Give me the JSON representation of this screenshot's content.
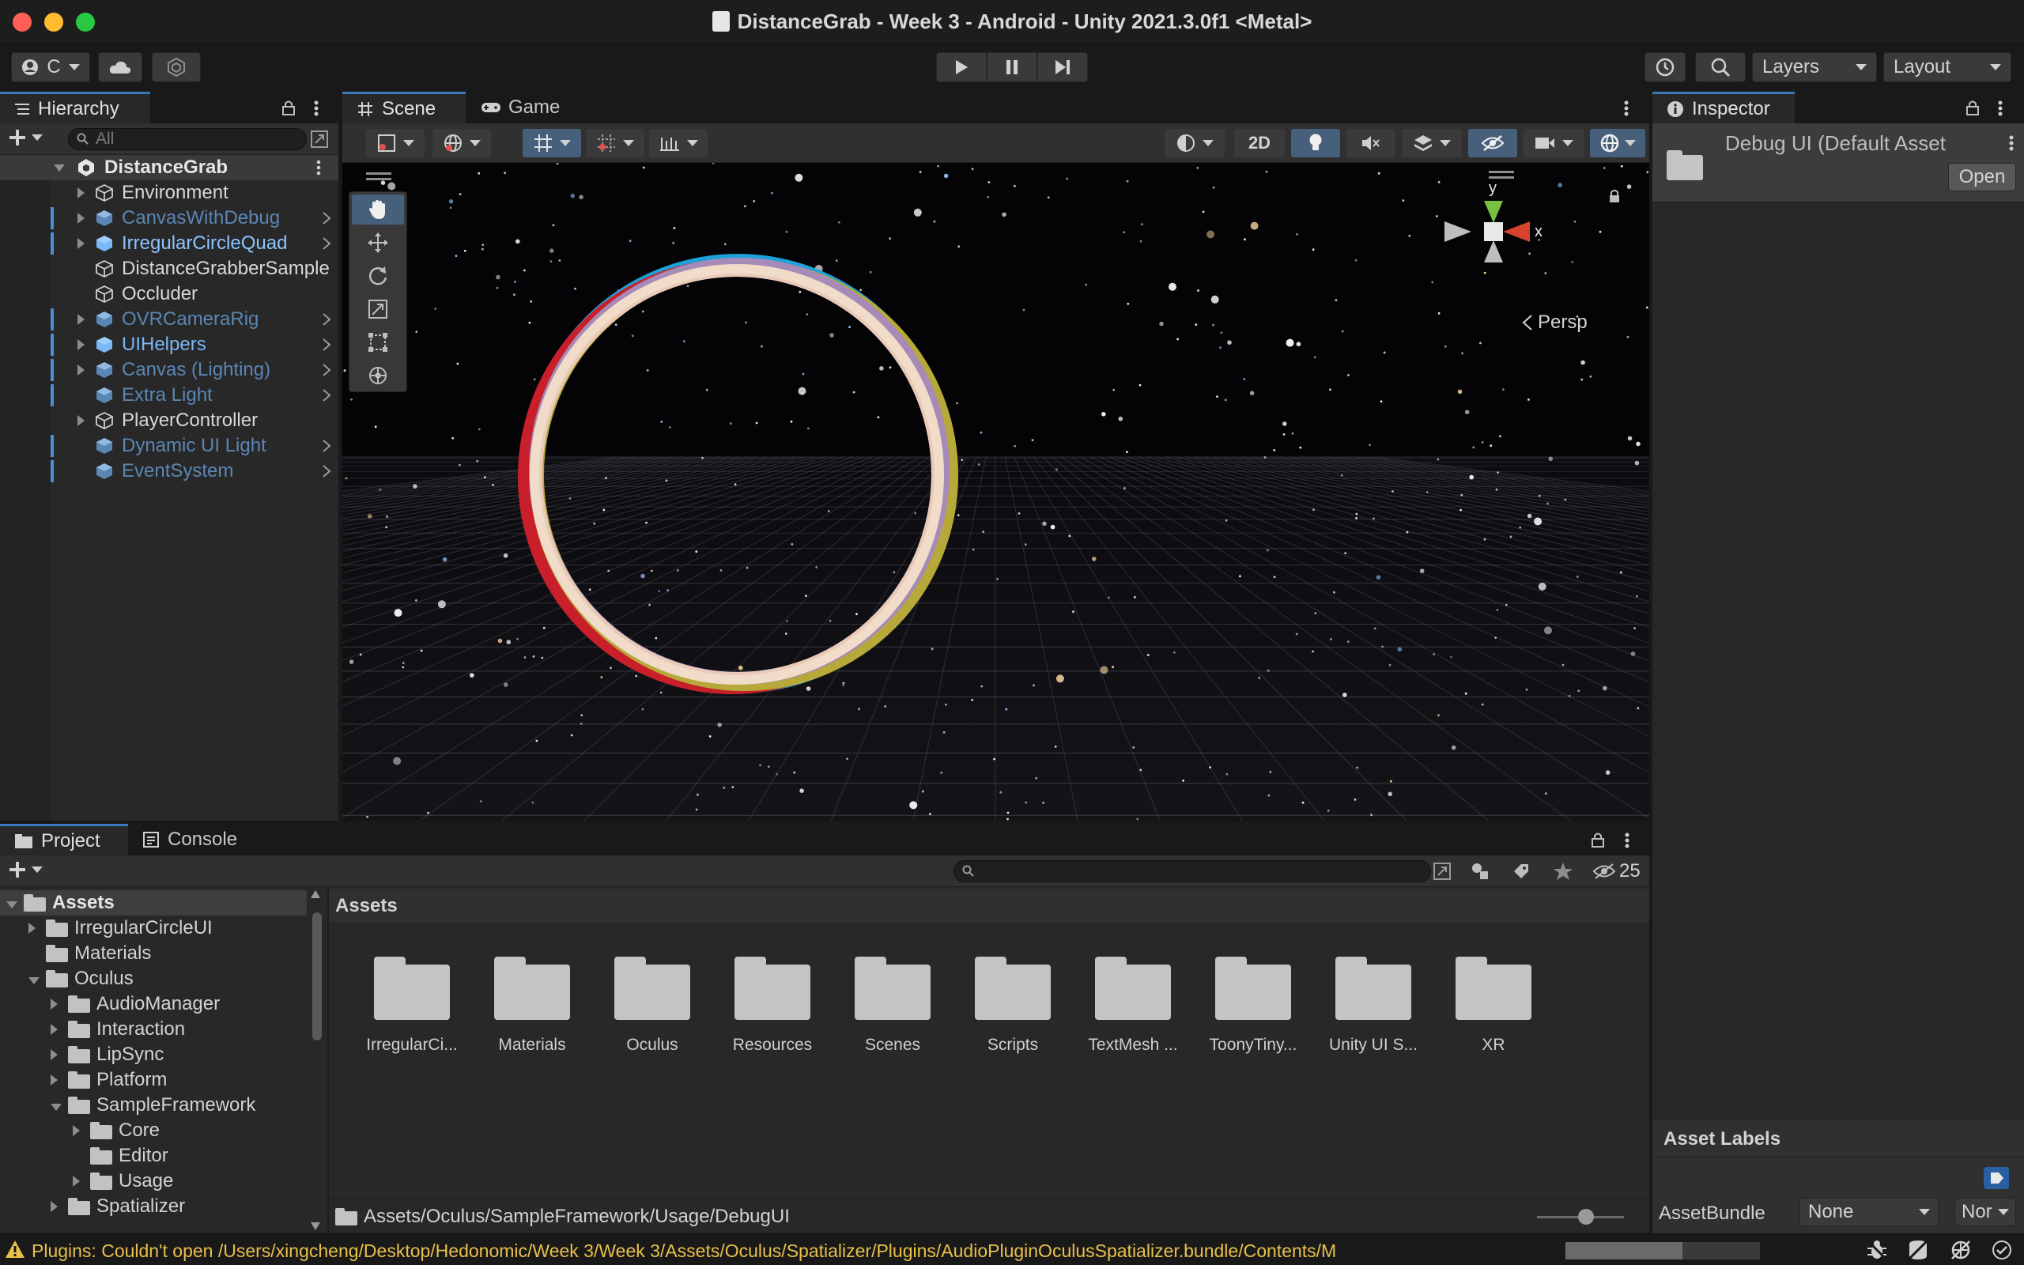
{
  "window": {
    "title": "DistanceGrab - Week 3 - Android - Unity 2021.3.0f1 <Metal>"
  },
  "toolbar": {
    "account_label": "C",
    "layers_label": "Layers",
    "layout_label": "Layout"
  },
  "hierarchy": {
    "tab_label": "Hierarchy",
    "search_placeholder": "All",
    "scene_name": "DistanceGrab",
    "items": [
      {
        "label": "Environment",
        "type": "object",
        "expandable": true
      },
      {
        "label": "CanvasWithDebug",
        "type": "prefab-inactive",
        "expandable": true,
        "chevron": true
      },
      {
        "label": "IrregularCircleQuad",
        "type": "prefab-selected",
        "expandable": true,
        "chevron": true
      },
      {
        "label": "DistanceGrabberSample",
        "type": "object",
        "expandable": false
      },
      {
        "label": "Occluder",
        "type": "object",
        "expandable": false
      },
      {
        "label": "OVRCameraRig",
        "type": "prefab-inactive",
        "expandable": true,
        "chevron": true
      },
      {
        "label": "UIHelpers",
        "type": "prefab",
        "expandable": true,
        "chevron": true
      },
      {
        "label": "Canvas (Lighting)",
        "type": "prefab-inactive",
        "expandable": true,
        "chevron": true
      },
      {
        "label": "Extra Light",
        "type": "prefab-inactive",
        "expandable": false,
        "chevron": true
      },
      {
        "label": "PlayerController",
        "type": "object",
        "expandable": true
      },
      {
        "label": "Dynamic UI Light",
        "type": "prefab-inactive",
        "expandable": false,
        "chevron": true
      },
      {
        "label": "EventSystem",
        "type": "prefab-inactive",
        "expandable": false,
        "chevron": true
      }
    ]
  },
  "scene": {
    "tabs": [
      {
        "label": "Scene"
      },
      {
        "label": "Game"
      }
    ],
    "mode_2d_label": "2D",
    "persp_label": "Persp",
    "gizmo": {
      "y_label": "y",
      "x_label": "x"
    }
  },
  "inspector": {
    "tab_label": "Inspector",
    "asset_title": "Debug UI (Default Asset",
    "open_label": "Open",
    "asset_labels_title": "Asset Labels",
    "assetbundle_label": "AssetBundle",
    "assetbundle_value": "None",
    "variant_value": "Nor"
  },
  "project": {
    "tabs": [
      {
        "label": "Project"
      },
      {
        "label": "Console"
      }
    ],
    "hidden_count": "25",
    "breadcrumb": "Assets",
    "path": "Assets/Oculus/SampleFramework/Usage/DebugUI",
    "tree": [
      {
        "label": "Assets",
        "depth": 0,
        "state": "open",
        "selected": true
      },
      {
        "label": "IrregularCircleUI",
        "depth": 1,
        "state": "closed"
      },
      {
        "label": "Materials",
        "depth": 1,
        "state": "none"
      },
      {
        "label": "Oculus",
        "depth": 1,
        "state": "open"
      },
      {
        "label": "AudioManager",
        "depth": 2,
        "state": "closed"
      },
      {
        "label": "Interaction",
        "depth": 2,
        "state": "closed"
      },
      {
        "label": "LipSync",
        "depth": 2,
        "state": "closed"
      },
      {
        "label": "Platform",
        "depth": 2,
        "state": "closed"
      },
      {
        "label": "SampleFramework",
        "depth": 2,
        "state": "open"
      },
      {
        "label": "Core",
        "depth": 3,
        "state": "closed"
      },
      {
        "label": "Editor",
        "depth": 3,
        "state": "none"
      },
      {
        "label": "Usage",
        "depth": 3,
        "state": "closed"
      },
      {
        "label": "Spatializer",
        "depth": 2,
        "state": "closed"
      }
    ],
    "grid": [
      "IrregularCi...",
      "Materials",
      "Oculus",
      "Resources",
      "Scenes",
      "Scripts",
      "TextMesh ...",
      "ToonyTiny...",
      "Unity UI S...",
      "XR"
    ]
  },
  "status": {
    "message": "Plugins: Couldn't open /Users/xingcheng/Desktop/Hedonomic/Week 3/Week 3/Assets/Oculus/Spatializer/Plugins/AudioPluginOculusSpatializer.bundle/Contents/M",
    "warning_color": "#e8c04a",
    "progress": 0.6
  },
  "colors": {
    "accent": "#3a79bb",
    "prefab_text": "#7ab5f5",
    "prefab_inactive_text": "#5b86b4",
    "selected_text": "#8cc4ff"
  }
}
